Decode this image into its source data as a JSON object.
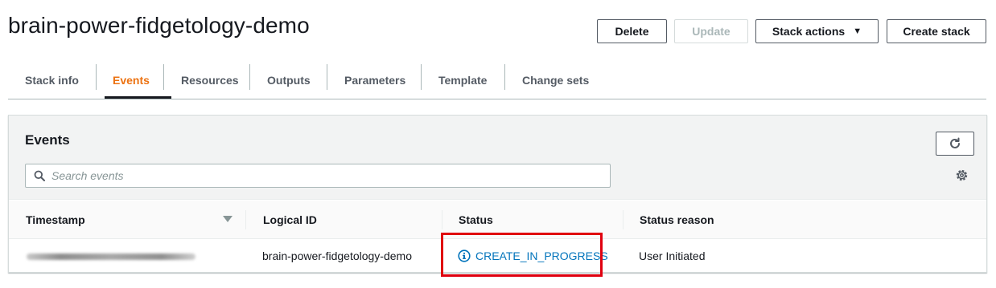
{
  "page": {
    "title": "brain-power-fidgetology-demo"
  },
  "header_actions": {
    "delete": "Delete",
    "update": "Update",
    "stack_actions": "Stack actions",
    "create_stack": "Create stack"
  },
  "tabs": [
    {
      "label": "Stack info",
      "active": false
    },
    {
      "label": "Events",
      "active": true
    },
    {
      "label": "Resources",
      "active": false
    },
    {
      "label": "Outputs",
      "active": false
    },
    {
      "label": "Parameters",
      "active": false
    },
    {
      "label": "Template",
      "active": false
    },
    {
      "label": "Change sets",
      "active": false
    }
  ],
  "events_panel": {
    "title": "Events",
    "search_placeholder": "Search events",
    "columns": [
      "Timestamp",
      "Logical ID",
      "Status",
      "Status reason"
    ],
    "rows": [
      {
        "timestamp": "",
        "logical_id": "brain-power-fidgetology-demo",
        "status": "CREATE_IN_PROGRESS",
        "status_reason": "User Initiated"
      }
    ]
  },
  "icons": {
    "refresh": "refresh-icon",
    "settings": "gear-icon",
    "search": "search-icon",
    "status_info": "info-icon",
    "dropdown": "caret-down-icon",
    "sort": "sort-desc-icon"
  },
  "colors": {
    "active_tab": "#ec7211",
    "status_link": "#0073bb",
    "highlight_box": "#e0000f"
  }
}
